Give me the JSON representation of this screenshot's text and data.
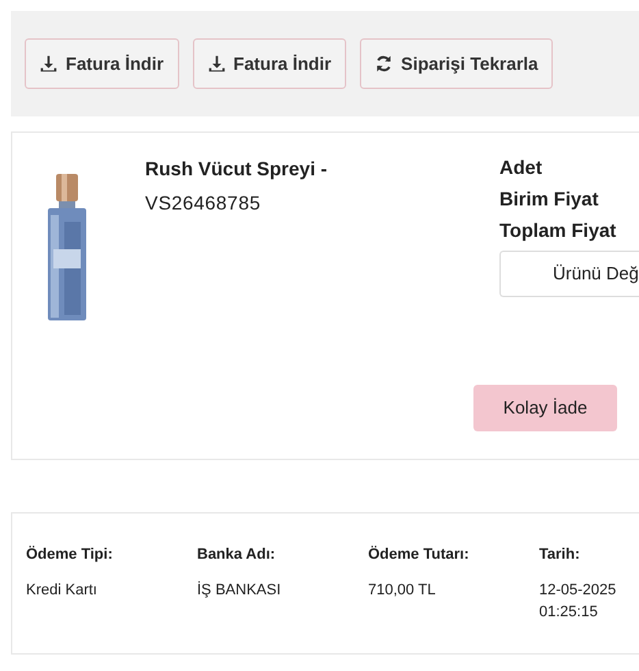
{
  "actions": [
    {
      "kind": "download",
      "label": "Fatura İndir"
    },
    {
      "kind": "download",
      "label": "Fatura İndir"
    },
    {
      "kind": "repeat",
      "label": "Siparişi Tekrarla"
    }
  ],
  "product": {
    "image": {
      "kind": "picture"
    },
    "name": "Rush Vücut Spreyi -",
    "code": "VS26468785",
    "labels": [
      "Adet",
      "Birim Fiyat",
      "Toplam Fiyat"
    ],
    "change_button": "Ürünü Değ",
    "return_button": "Kolay İade"
  },
  "payment": {
    "columns": [
      {
        "heading": "Ödeme Tipi:",
        "lines": [
          "Kredi Kartı"
        ]
      },
      {
        "heading": "Banka Adı:",
        "lines": [
          "İŞ BANKASI"
        ]
      },
      {
        "heading": "Ödeme Tutarı:",
        "lines": [
          "710,00 TL"
        ]
      },
      {
        "heading": "Tarih:",
        "lines": [
          "12-05-2025",
          "01:25:15"
        ]
      }
    ]
  }
}
